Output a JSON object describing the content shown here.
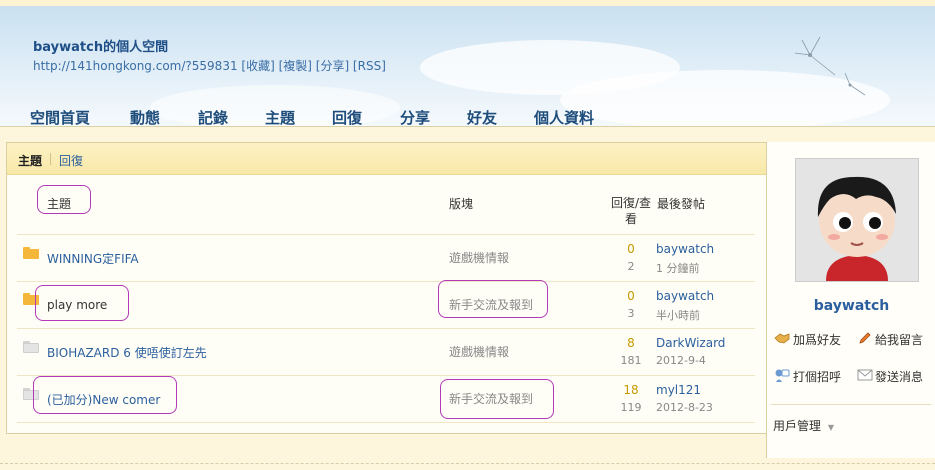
{
  "header": {
    "site_title": "baywatch的個人空間",
    "site_url": "http://141hongkong.com/?559831 [收藏] [複製] [分享] [RSS]",
    "nav": [
      "空間首頁",
      "動態",
      "記錄",
      "主題",
      "回復",
      "分享",
      "好友",
      "個人資料"
    ]
  },
  "tabs": {
    "topic": "主題",
    "reply": "回復"
  },
  "table": {
    "headers": {
      "topic": "主題",
      "forum": "版塊",
      "replies_views": "回復/查看",
      "last_post": "最後發帖"
    },
    "rows": [
      {
        "title": "WINNING定FIFA",
        "forum": "遊戲機情報",
        "replies": "0",
        "views": "2",
        "user": "baywatch",
        "date": "1 分鐘前",
        "icon": "folder-yellow-icon"
      },
      {
        "title": "play more",
        "forum": "新手交流及報到",
        "replies": "0",
        "views": "3",
        "user": "baywatch",
        "date": "半小時前",
        "icon": "folder-yellow-icon"
      },
      {
        "title": "BIOHAZARD 6 使唔使訂左先",
        "forum": "遊戲機情報",
        "replies": "8",
        "views": "181",
        "user": "DarkWizard",
        "date": "2012-9-4",
        "icon": "folder-grey-icon"
      },
      {
        "title": "(已加分)New comer",
        "forum": "新手交流及報到",
        "replies": "18",
        "views": "119",
        "user": "myl121",
        "date": "2012-8-23",
        "icon": "folder-grey-icon"
      }
    ]
  },
  "sidebar": {
    "username": "baywatch",
    "add_friend": "加爲好友",
    "leave_message": "給我留言",
    "greet": "打個招呼",
    "send_message": "發送消息",
    "user_manage": "用戶管理",
    "manage_arrow": "▼"
  },
  "colors": {
    "accent": "#2b5f9e",
    "highlight_mark": "#b23ab8",
    "tab_bar": "#f8e8a8"
  }
}
